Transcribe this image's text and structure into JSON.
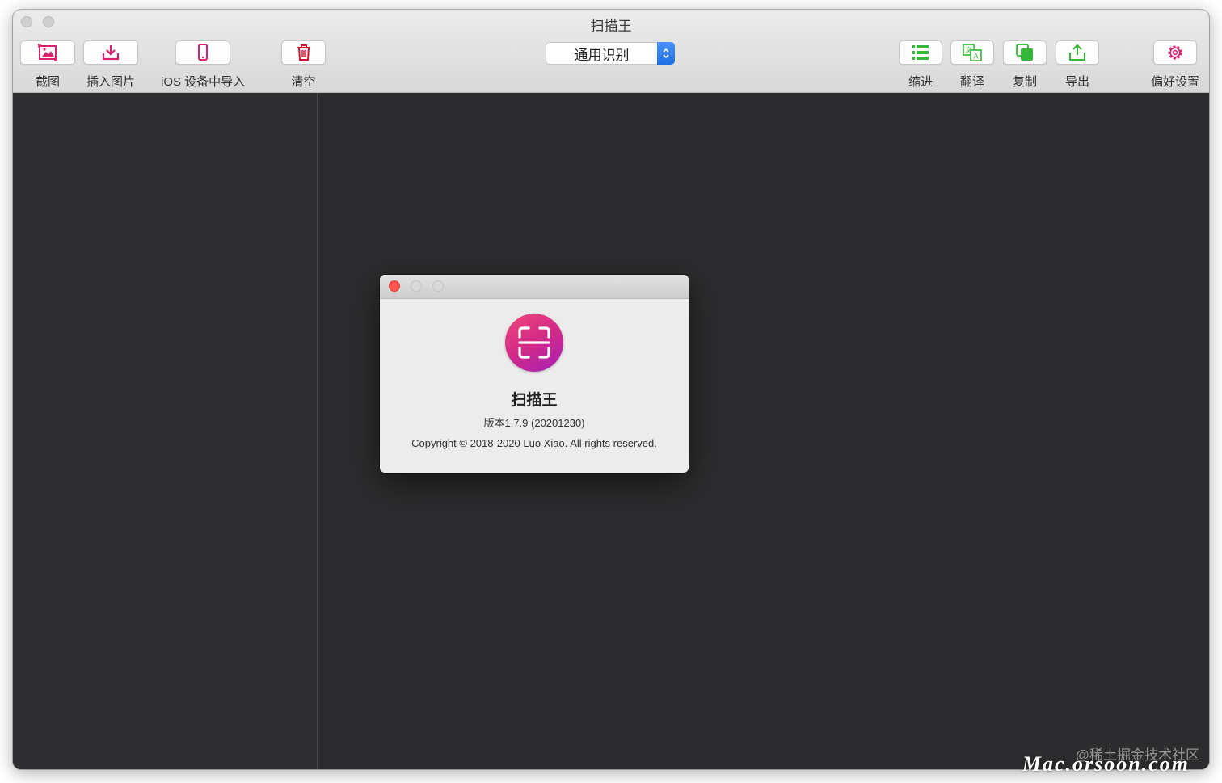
{
  "window": {
    "title": "扫描王"
  },
  "toolbar": {
    "left": [
      {
        "label": "截图",
        "icon": "screenshot-icon"
      },
      {
        "label": "插入图片",
        "icon": "insert-image-icon"
      },
      {
        "label": "iOS 设备中导入",
        "icon": "iphone-icon"
      },
      {
        "label": "清空",
        "icon": "trash-icon"
      }
    ],
    "mode_select": {
      "value": "通用识别"
    },
    "right": [
      {
        "label": "缩进",
        "icon": "list-indent-icon"
      },
      {
        "label": "翻译",
        "icon": "translate-icon"
      },
      {
        "label": "复制",
        "icon": "copy-icon"
      },
      {
        "label": "导出",
        "icon": "export-icon"
      },
      {
        "label": "偏好设置",
        "icon": "gear-icon"
      }
    ]
  },
  "about_dialog": {
    "app_name": "扫描王",
    "version": "版本1.7.9 (20201230)",
    "copyright": "Copyright © 2018-2020 Luo Xiao. All rights reserved."
  },
  "watermark": {
    "community": "@稀土掘金技术社区",
    "site": "Mac.orsoon.com"
  },
  "colors": {
    "accent_pink": "#d6226f",
    "accent_green": "#35b73a",
    "accent_blue": "#1d6fe6",
    "close_red": "#fc5753"
  }
}
